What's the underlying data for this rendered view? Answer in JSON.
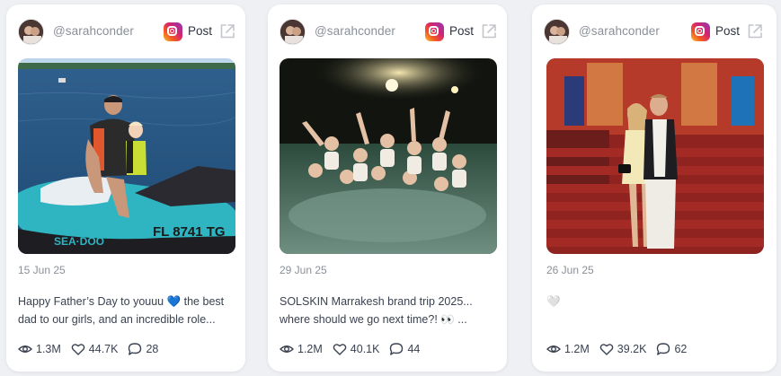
{
  "posts": [
    {
      "handle": "@sarahconder",
      "platform_icon": "instagram-icon",
      "type_label": "Post",
      "date": "15 Jun 25",
      "caption_line1": "Happy Father’s Day to youuu 💙 the best",
      "caption_line2": "dad to our girls, and an incredible role...",
      "views": "1.3M",
      "likes": "44.7K",
      "comments": "28",
      "photo_alt": "jet-ski-photo"
    },
    {
      "handle": "@sarahconder",
      "platform_icon": "instagram-icon",
      "type_label": "Post",
      "date": "29 Jun 25",
      "caption_line1": "SOLSKIN Marrakesh brand trip 2025...",
      "caption_line2": "where should we go next time?! 👀 ...",
      "views": "1.2M",
      "likes": "40.1K",
      "comments": "44",
      "photo_alt": "pool-party-photo"
    },
    {
      "handle": "@sarahconder",
      "platform_icon": "instagram-icon",
      "type_label": "Post",
      "date": "26 Jun 25",
      "caption_line1": "🤍",
      "caption_line2": "",
      "views": "1.2M",
      "likes": "39.2K",
      "comments": "62",
      "photo_alt": "red-carpet-photo"
    }
  ],
  "colors": {
    "card_bg": "#ffffff",
    "page_bg": "#eef0f4",
    "muted_text": "#8a8f98",
    "body_text": "#3a4150"
  }
}
